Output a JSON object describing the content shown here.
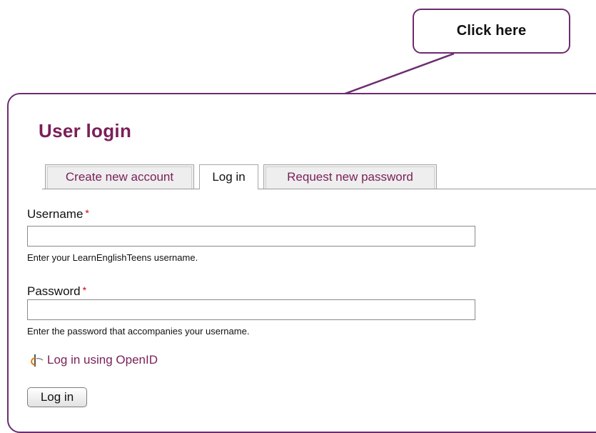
{
  "callout": {
    "text": "Click here"
  },
  "page": {
    "title": "User login"
  },
  "tabs": [
    {
      "label": "Create new account",
      "active": false
    },
    {
      "label": "Log in",
      "active": true
    },
    {
      "label": "Request new password",
      "active": false
    }
  ],
  "form": {
    "username": {
      "label": "Username",
      "required_mark": "*",
      "value": "",
      "help": "Enter your LearnEnglishTeens username."
    },
    "password": {
      "label": "Password",
      "required_mark": "*",
      "value": "",
      "help": "Enter the password that accompanies your username."
    },
    "openid": {
      "label": "Log in using OpenID",
      "icon": "openid-icon"
    },
    "submit_label": "Log in"
  },
  "colors": {
    "accent": "#6b2d6f",
    "title": "#7a1f58",
    "required": "#d0021b"
  }
}
